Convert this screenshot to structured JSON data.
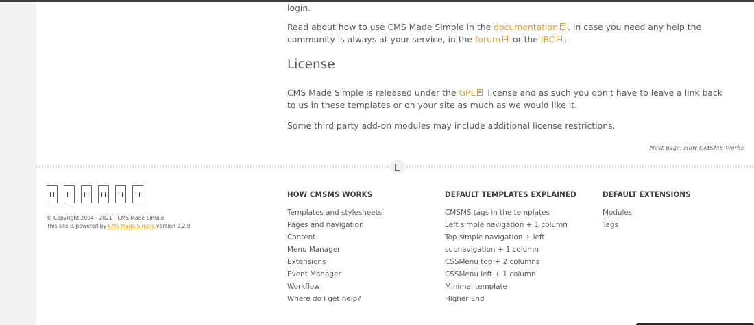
{
  "article": {
    "login_text": "login.",
    "doc_para": {
      "pre": "Read about how to use CMS Made Simple in the ",
      "link1": "documentation",
      "mid": ". In case you need any help the community is always at your service, in the ",
      "link2": "forum",
      "mid2": " or the ",
      "link3": "IRC",
      "post": "."
    },
    "license_heading": "License",
    "gpl_para": {
      "pre": "CMS Made Simple is released under the ",
      "link": "GPL",
      "post": " license and as such you don't have to leave a link back to us in these templates or on your site as much as we would like it."
    },
    "third_party": "Some third party add-on modules may include additional license restrictions.",
    "next_page": "Next page: How CMSMS Works"
  },
  "footer": {
    "social_icons": [
      "social-icon-1",
      "social-icon-2",
      "social-icon-3",
      "social-icon-4",
      "social-icon-5",
      "social-icon-6"
    ],
    "copyright": "© Copyright 2004 - 2021 - CMS Made Simple",
    "powered_pre": "This site is powered by ",
    "powered_link": "CMS Made Simple",
    "powered_post": " version 2.2.8",
    "columns": [
      {
        "heading": "HOW CMSMS WORKS",
        "items": [
          "Templates and stylesheets",
          "Pages and navigation",
          "Content",
          "Menu Manager",
          "Extensions",
          "Event Manager",
          "Workflow",
          "Where do i get help?"
        ]
      },
      {
        "heading": "DEFAULT TEMPLATES EXPLAINED",
        "items": [
          "CMSMS tags in the templates",
          "Left simple navigation + 1 column",
          "Top simple navigation + left subnavigation + 1 column",
          "CSSMenu top + 2 columns",
          "CSSMenu left + 1 column",
          "Minimal template",
          "Higher End"
        ]
      },
      {
        "heading": "DEFAULT EXTENSIONS",
        "items": [
          "Modules",
          "Tags"
        ]
      }
    ]
  },
  "colors": {
    "accent": "#e8a020",
    "text": "#5a5a5a",
    "heading": "#3e3e3e",
    "topbar": "#3d3d3d"
  }
}
